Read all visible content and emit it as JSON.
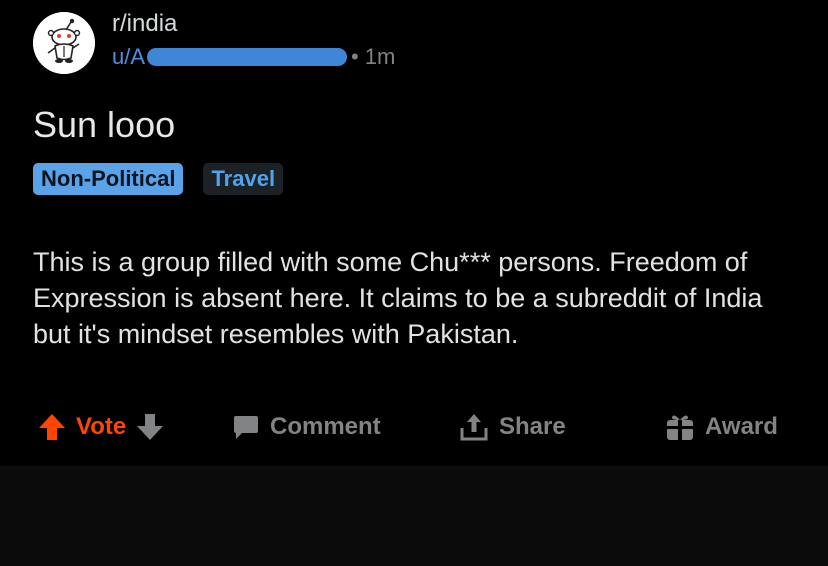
{
  "header": {
    "subreddit": "r/india",
    "user_prefix": "u/A",
    "age": "1m"
  },
  "post": {
    "title": "Sun looo",
    "flairs": [
      "Non-Political",
      "Travel"
    ],
    "body": "This is a group filled with some Chu*** persons. Freedom of Expression is absent here. It claims to be a subreddit of India but it's mindset resembles with Pakistan."
  },
  "actions": {
    "vote_label": "Vote",
    "comment_label": "Comment",
    "share_label": "Share",
    "award_label": "Award"
  },
  "colors": {
    "background": "#000000",
    "upvote": "#ff4500",
    "link_blue": "#4f8fe0",
    "flair_primary": "#5aa3e8",
    "muted": "#818384"
  },
  "icons": {
    "avatar": "snoo-icon",
    "upvote": "arrow-up-icon",
    "downvote": "arrow-down-icon",
    "comment": "comment-bubble-icon",
    "share": "share-upload-icon",
    "award": "gift-icon"
  }
}
